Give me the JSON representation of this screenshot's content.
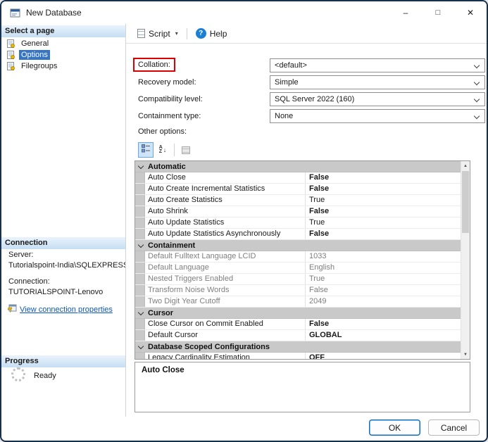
{
  "window": {
    "title": "New Database",
    "controls": {
      "minimize": "–",
      "maximize": "□",
      "close": "✕"
    }
  },
  "colors": {
    "highlight_box": "#dd0000",
    "selected_page_bg": "#3575c4",
    "link": "#0a58ba",
    "help_icon": "#1b7fd4",
    "category_row": "#c9c9c9"
  },
  "sidebar": {
    "select_page_header": "Select a page",
    "pages": [
      {
        "label": "General",
        "selected": false
      },
      {
        "label": "Options",
        "selected": true
      },
      {
        "label": "Filegroups",
        "selected": false
      }
    ],
    "connection": {
      "header": "Connection",
      "server_label": "Server:",
      "server_value": "Tutorialspoint-India\\SQLEXPRESS",
      "connection_label": "Connection:",
      "connection_value": "TUTORIALSPOINT-Lenovo",
      "link": "View connection properties"
    },
    "progress": {
      "header": "Progress",
      "status": "Ready"
    }
  },
  "toolbar": {
    "script_label": "Script",
    "script_dropdown_icon": "▾",
    "help_label": "Help",
    "help_icon": "?"
  },
  "form": {
    "fields": [
      {
        "label": "Collation:",
        "value": "<default>",
        "highlighted": true
      },
      {
        "label": "Recovery model:",
        "value": "Simple",
        "highlighted": false
      },
      {
        "label": "Compatibility level:",
        "value": "SQL Server 2022 (160)",
        "highlighted": false
      },
      {
        "label": "Containment type:",
        "value": "None",
        "highlighted": false
      }
    ],
    "other_options_label": "Other options:"
  },
  "grid_toolbar": {
    "sort_a": "A",
    "sort_z": "Z",
    "sort_arrow": "↓"
  },
  "property_grid": {
    "groups": [
      {
        "name": "Automatic",
        "rows": [
          {
            "property": "Auto Close",
            "value": "False",
            "emphasis": "bold"
          },
          {
            "property": "Auto Create Incremental Statistics",
            "value": "False",
            "emphasis": "bold"
          },
          {
            "property": "Auto Create Statistics",
            "value": "True",
            "emphasis": "normal"
          },
          {
            "property": "Auto Shrink",
            "value": "False",
            "emphasis": "bold"
          },
          {
            "property": "Auto Update Statistics",
            "value": "True",
            "emphasis": "normal"
          },
          {
            "property": "Auto Update Statistics Asynchronously",
            "value": "False",
            "emphasis": "bold"
          }
        ]
      },
      {
        "name": "Containment",
        "rows": [
          {
            "property": "Default Fulltext Language LCID",
            "value": "1033",
            "emphasis": "disabled"
          },
          {
            "property": "Default Language",
            "value": "English",
            "emphasis": "disabled"
          },
          {
            "property": "Nested Triggers Enabled",
            "value": "True",
            "emphasis": "disabled"
          },
          {
            "property": "Transform Noise Words",
            "value": "False",
            "emphasis": "disabled"
          },
          {
            "property": "Two Digit Year Cutoff",
            "value": "2049",
            "emphasis": "disabled"
          }
        ]
      },
      {
        "name": "Cursor",
        "rows": [
          {
            "property": "Close Cursor on Commit Enabled",
            "value": "False",
            "emphasis": "bold"
          },
          {
            "property": "Default Cursor",
            "value": "GLOBAL",
            "emphasis": "bold"
          }
        ]
      },
      {
        "name": "Database Scoped Configurations",
        "rows": [
          {
            "property": "Legacy Cardinality Estimation",
            "value": "OFF",
            "emphasis": "bold"
          }
        ]
      }
    ],
    "description_title": "Auto Close"
  },
  "scrollbar": {
    "up": "▲",
    "down": "▼"
  },
  "footer": {
    "ok_label": "OK",
    "cancel_label": "Cancel"
  }
}
